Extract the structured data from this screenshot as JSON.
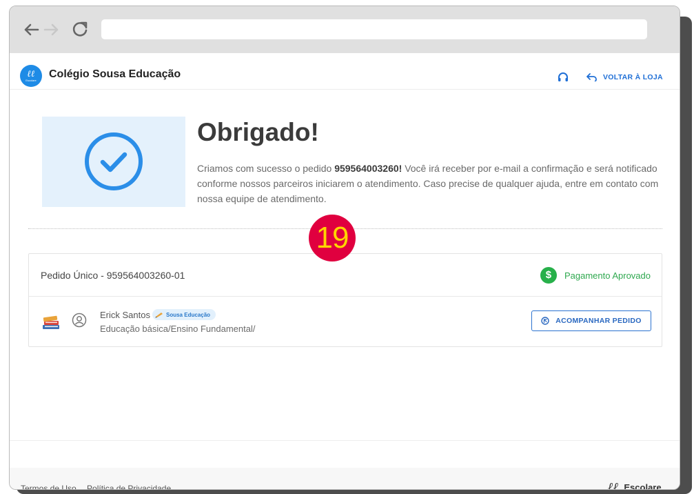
{
  "browser": {
    "address": ""
  },
  "header": {
    "logo_text": "Escolare",
    "school_name": "Colégio Sousa Educação",
    "back_label": "VOLTAR À LOJA"
  },
  "confirmation": {
    "title": "Obrigado!",
    "text_before": "Criamos com sucesso o pedido ",
    "order_number": "959564003260!",
    "text_after": " Você irá receber por e-mail a confirmação e será notificado conforme nossos parceiros iniciarem o atendimento. Caso precise de qualquer ajuda, entre em contato com nossa equipe de atendimento."
  },
  "annotation": {
    "step_number": "19",
    "badge_color": "#e0003f",
    "number_color": "#ffd400"
  },
  "order": {
    "title": "Pedido Único - 959564003260-01",
    "payment_status": "Pagamento Aprovado",
    "payment_symbol": "$",
    "student_name": "Erick Santos",
    "school_tag": "Sousa Educação",
    "course": "Educação básica/Ensino Fundamental/",
    "track_button": "ACOMPANHAR PEDIDO"
  },
  "footer": {
    "terms": "Termos de Uso",
    "privacy": "Política de Privacidade",
    "brand": "Escolare",
    "brand_mark": "ℓℓ"
  },
  "colors": {
    "primary": "#1e8be6",
    "link": "#1f6fd6",
    "success": "#27b04a"
  },
  "icons": [
    "back-arrow-icon",
    "forward-arrow-icon",
    "reload-icon",
    "headset-icon",
    "return-arrow-icon",
    "check-circle-icon",
    "dollar-icon",
    "books-icon",
    "user-circle-icon",
    "crayon-icon",
    "track-icon"
  ]
}
